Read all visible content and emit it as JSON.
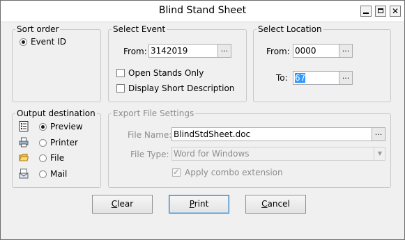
{
  "window": {
    "title": "Blind Stand Sheet"
  },
  "sort_order": {
    "legend": "Sort order",
    "options": [
      {
        "label": "Event ID",
        "selected": true
      }
    ]
  },
  "select_event": {
    "legend": "Select Event",
    "from_label": "From:",
    "from_value": "3142019",
    "open_stands_only": {
      "label": "Open Stands Only",
      "checked": false
    },
    "display_short_description": {
      "label": "Display Short Description",
      "checked": false
    }
  },
  "select_location": {
    "legend": "Select Location",
    "from_label": "From:",
    "from_value": "0000",
    "to_label": "To:",
    "to_value": "67"
  },
  "output_destination": {
    "legend": "Output destination",
    "options": [
      {
        "label": "Preview",
        "selected": true,
        "icon": "preview-icon"
      },
      {
        "label": "Printer",
        "selected": false,
        "icon": "printer-icon"
      },
      {
        "label": "File",
        "selected": false,
        "icon": "folder-icon"
      },
      {
        "label": "Mail",
        "selected": false,
        "icon": "mail-icon"
      }
    ]
  },
  "export_file_settings": {
    "legend": "Export File Settings",
    "file_name_label": "File Name:",
    "file_name_value": "BlindStdSheet.doc",
    "file_type_label": "File Type:",
    "file_type_value": "Word for Windows",
    "apply_combo_extension": {
      "label": "Apply combo extension",
      "checked": true
    }
  },
  "buttons": {
    "clear_mnemonic": "C",
    "clear_rest": "lear",
    "print_mnemonic": "P",
    "print_rest": "rint",
    "cancel_mnemonic": "C",
    "cancel_rest": "ancel"
  },
  "ellipsis": "...",
  "colors": {
    "selection": "#3399ff",
    "default_button_border": "#3c7fb1",
    "disabled_text": "#8d8d8d"
  }
}
